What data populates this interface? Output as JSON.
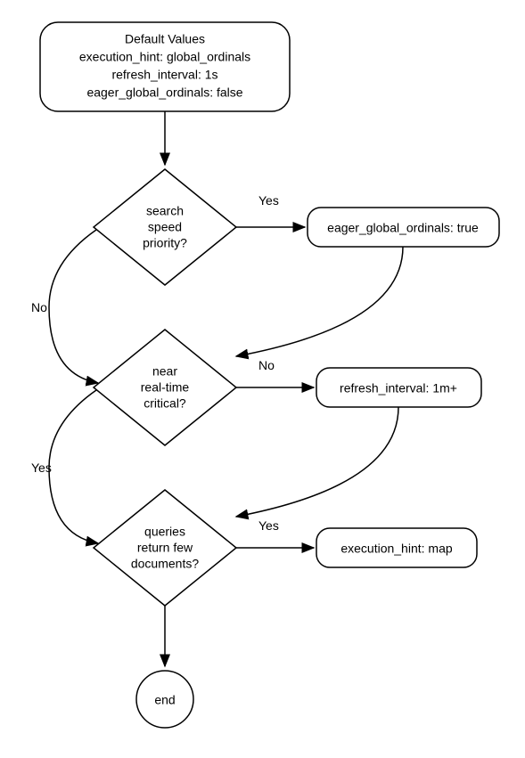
{
  "chart_data": {
    "type": "flowchart",
    "nodes": [
      {
        "id": "start",
        "type": "rounded-rect",
        "lines": [
          "Default Values",
          "execution_hint: global_ordinals",
          "refresh_interval: 1s",
          "eager_global_ordinals: false"
        ]
      },
      {
        "id": "decision1",
        "type": "diamond",
        "lines": [
          "search",
          "speed",
          "priority?"
        ]
      },
      {
        "id": "action1",
        "type": "rounded-rect",
        "lines": [
          "eager_global_ordinals: true"
        ]
      },
      {
        "id": "decision2",
        "type": "diamond",
        "lines": [
          "near",
          "real-time",
          "critical?"
        ]
      },
      {
        "id": "action2",
        "type": "rounded-rect",
        "lines": [
          "refresh_interval: 1m+"
        ]
      },
      {
        "id": "decision3",
        "type": "diamond",
        "lines": [
          "queries",
          "return few",
          "documents?"
        ]
      },
      {
        "id": "action3",
        "type": "rounded-rect",
        "lines": [
          "execution_hint: map"
        ]
      },
      {
        "id": "end",
        "type": "circle",
        "lines": [
          "end"
        ]
      }
    ],
    "edges": [
      {
        "from": "start",
        "to": "decision1",
        "label": ""
      },
      {
        "from": "decision1",
        "to": "action1",
        "label": "Yes"
      },
      {
        "from": "decision1",
        "to": "decision2",
        "label": "No"
      },
      {
        "from": "action1",
        "to": "decision2",
        "label": ""
      },
      {
        "from": "decision2",
        "to": "action2",
        "label": "No"
      },
      {
        "from": "decision2",
        "to": "decision3",
        "label": "Yes"
      },
      {
        "from": "action2",
        "to": "decision3",
        "label": ""
      },
      {
        "from": "decision3",
        "to": "action3",
        "label": "Yes"
      },
      {
        "from": "decision3",
        "to": "end",
        "label": ""
      }
    ]
  },
  "labels": {
    "yes1": "Yes",
    "no1": "No",
    "no2": "No",
    "yes2": "Yes",
    "yes3": "Yes"
  }
}
